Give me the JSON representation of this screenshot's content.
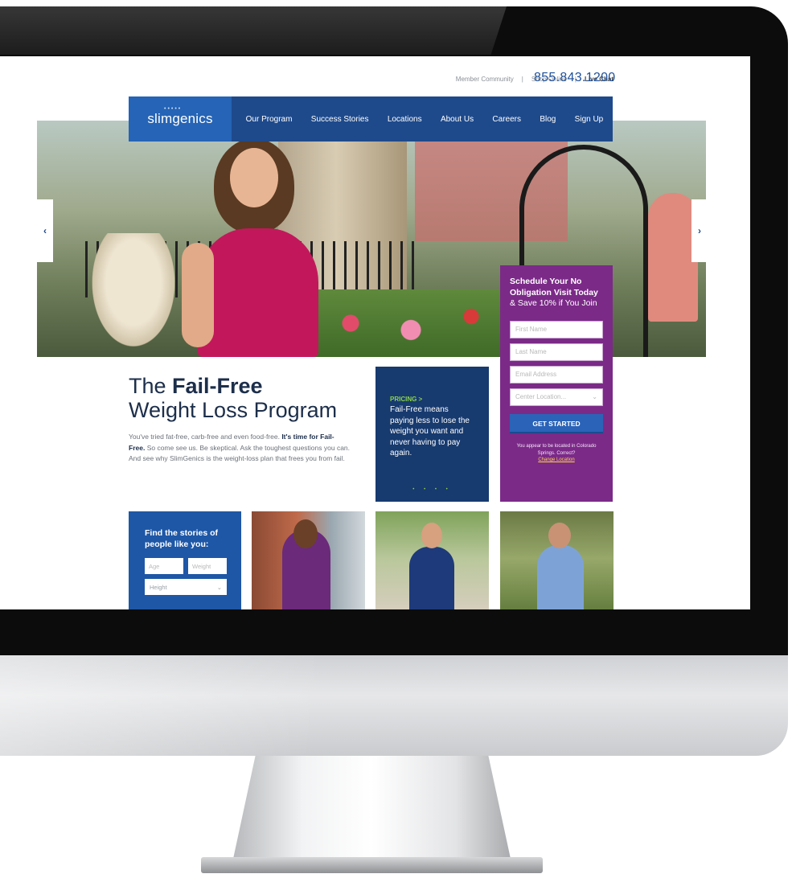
{
  "utility_nav": {
    "member_community": "Member Community",
    "shop_online": "Shop Online",
    "live_chat": "Live Chat",
    "phone": "855.843.1200"
  },
  "brand": {
    "name": "slimgenics",
    "mark": "•••••"
  },
  "nav": {
    "items": [
      "Our Program",
      "Success Stories",
      "Locations",
      "About Us",
      "Careers",
      "Blog",
      "Sign Up"
    ]
  },
  "hero": {
    "prev_icon": "‹",
    "next_icon": "›"
  },
  "schedule": {
    "title_bold": "Schedule Your No Obligation Visit Today",
    "title_rest": "& Save 10% if You Join",
    "first_name_placeholder": "First Name",
    "last_name_placeholder": "Last Name",
    "email_placeholder": "Email Address",
    "center_placeholder": "Center Location...",
    "button": "GET STARTED",
    "locate_text": "You appear to be located in Colorado Springs. Correct?",
    "change_location": "Change Location"
  },
  "headline": {
    "line1_pre": "The ",
    "line1_bold": "Fail-Free",
    "line2": "Weight Loss Program",
    "intro_1": "You've tried fat-free, carb-free and even food-free. ",
    "intro_bold": "It's time for Fail-Free.",
    "intro_2": " So come see us. Be skeptical. Ask the toughest questions you can. And see why SlimGenics is the weight-loss plan that frees you from fail."
  },
  "pricing": {
    "label": "PRICING >",
    "text": "Fail-Free means paying less to lose the weight you want and never having to pay again.",
    "dots": "• • • •"
  },
  "stories": {
    "title": "Find the stories of people like you:",
    "age_placeholder": "Age",
    "weight_placeholder": "Weight",
    "height_placeholder": "Height"
  },
  "colors": {
    "nav_blue": "#1e4a8c",
    "logo_blue": "#2564b6",
    "schedule_purple": "#7b2a88",
    "pricing_navy": "#173a6f",
    "accent_green": "#8bd34a",
    "phone_blue": "#1d4f9a"
  }
}
